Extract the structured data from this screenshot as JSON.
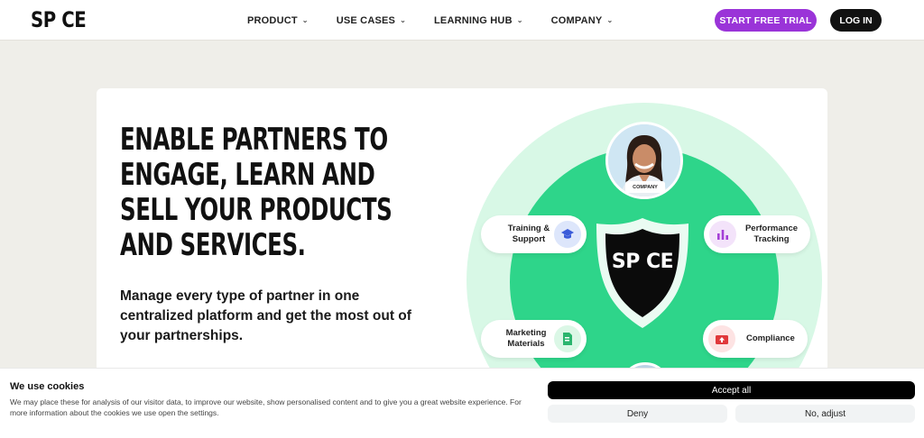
{
  "header": {
    "logo": "SP CE",
    "nav": [
      {
        "label": "PRODUCT"
      },
      {
        "label": "USE CASES"
      },
      {
        "label": "LEARNING HUB"
      },
      {
        "label": "COMPANY"
      }
    ],
    "trial_label": "START FREE TRIAL",
    "login_label": "LOG IN"
  },
  "hero": {
    "title": "ENABLE PARTNERS TO ENGAGE, LEARN AND SELL YOUR PRODUCTS AND SERVICES.",
    "subtitle": "Manage every type of partner in one centralized platform and get the most out of your partnerships."
  },
  "diagram": {
    "company_tag": "COMPANY",
    "shield_label": "SP CE",
    "items": {
      "training": "Training & Support",
      "performance": "Performance Tracking",
      "marketing": "Marketing Materials",
      "compliance": "Compliance"
    },
    "icons": {
      "training": "graduation-cap-icon",
      "performance": "bar-chart-icon",
      "marketing": "document-icon",
      "compliance": "upload-box-icon"
    },
    "colors": {
      "outer_ring": "#d8f8e6",
      "inner_ring": "#2ed58a",
      "brand_purple": "#9a34d8"
    }
  },
  "cookie": {
    "title": "We use cookies",
    "text": "We may place these for analysis of our visitor data, to improve our website, show personalised content and to give you a great website experience. For more information about the cookies we use open the settings.",
    "accept_label": "Accept all",
    "deny_label": "Deny",
    "adjust_label": "No, adjust"
  }
}
